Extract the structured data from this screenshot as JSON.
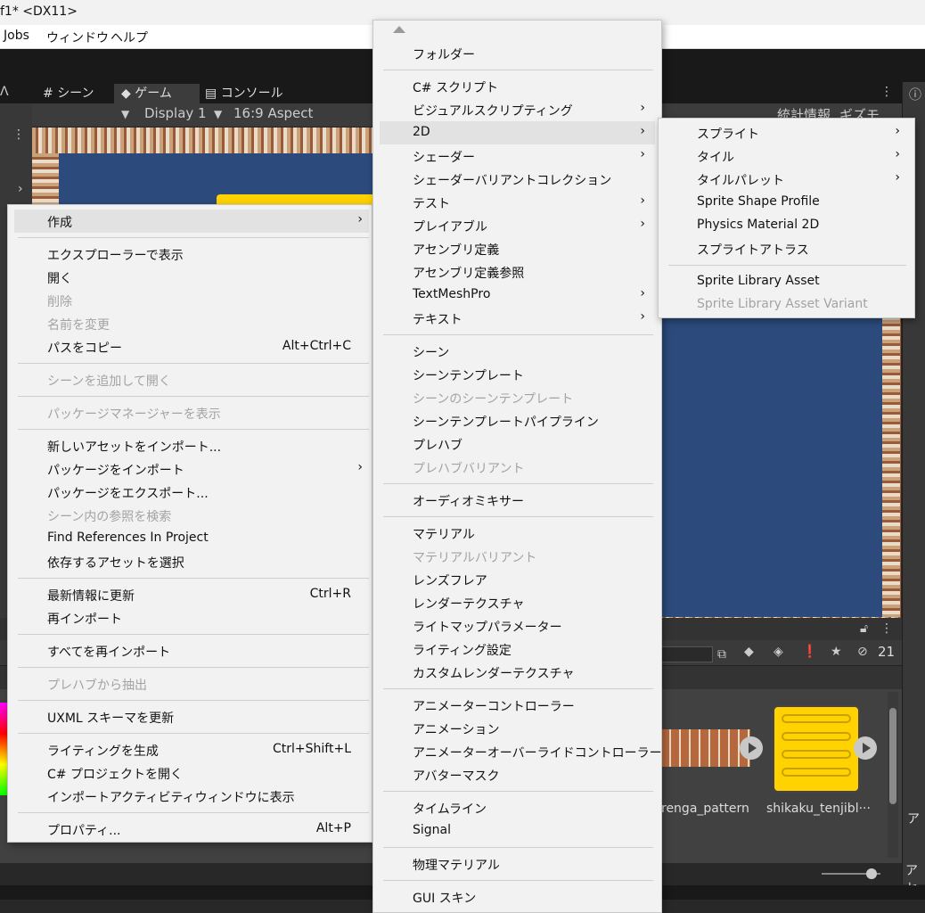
{
  "title": "f1* <DX11>",
  "menubar": [
    "Jobs",
    "ウィンドウ",
    "ヘルプ"
  ],
  "tabs": {
    "scene": "シーン",
    "game": "ゲーム",
    "console": "コンソール"
  },
  "game_toolbar": {
    "display": "Display 1",
    "aspect": "16:9 Aspect",
    "stats": "統計情報",
    "gizmos": "ギズモ"
  },
  "project": {
    "hidden_count": "21",
    "assets": [
      "renga_pattern",
      "shikaku_tenjibl···"
    ]
  },
  "right_panel": {
    "header_a": "ア",
    "footer_a": "アセ"
  },
  "context_menu": [
    {
      "label": "作成",
      "submenu": true,
      "highlighted": true
    },
    {
      "sep": true
    },
    {
      "label": "エクスプローラーで表示"
    },
    {
      "label": "開く"
    },
    {
      "label": "削除",
      "disabled": true
    },
    {
      "label": "名前を変更",
      "disabled": true
    },
    {
      "label": "パスをコピー",
      "shortcut": "Alt+Ctrl+C"
    },
    {
      "sep": true
    },
    {
      "label": "シーンを追加して開く",
      "disabled": true
    },
    {
      "sep": true
    },
    {
      "label": "パッケージマネージャーを表示",
      "disabled": true
    },
    {
      "sep": true
    },
    {
      "label": "新しいアセットをインポート..."
    },
    {
      "label": "パッケージをインポート",
      "submenu": true
    },
    {
      "label": "パッケージをエクスポート..."
    },
    {
      "label": "シーン内の参照を検索",
      "disabled": true
    },
    {
      "label": "Find References In Project"
    },
    {
      "label": "依存するアセットを選択"
    },
    {
      "sep": true
    },
    {
      "label": "最新情報に更新",
      "shortcut": "Ctrl+R"
    },
    {
      "label": "再インポート"
    },
    {
      "sep": true
    },
    {
      "label": "すべてを再インポート"
    },
    {
      "sep": true
    },
    {
      "label": "プレハブから抽出",
      "disabled": true
    },
    {
      "sep": true
    },
    {
      "label": "UXML スキーマを更新"
    },
    {
      "sep": true
    },
    {
      "label": "ライティングを生成",
      "shortcut": "Ctrl+Shift+L"
    },
    {
      "label": "C# プロジェクトを開く"
    },
    {
      "label": "インポートアクティビティウィンドウに表示"
    },
    {
      "sep": true
    },
    {
      "label": "プロパティ...",
      "shortcut": "Alt+P"
    }
  ],
  "create_menu": [
    {
      "label": "フォルダー"
    },
    {
      "sep": true
    },
    {
      "label": "C# スクリプト"
    },
    {
      "label": "ビジュアルスクリプティング",
      "submenu": true
    },
    {
      "label": "2D",
      "submenu": true,
      "highlighted": true
    },
    {
      "label": "シェーダー",
      "submenu": true
    },
    {
      "label": "シェーダーバリアントコレクション"
    },
    {
      "label": "テスト",
      "submenu": true
    },
    {
      "label": "プレイアブル",
      "submenu": true
    },
    {
      "label": "アセンブリ定義"
    },
    {
      "label": "アセンブリ定義参照"
    },
    {
      "label": "TextMeshPro",
      "submenu": true
    },
    {
      "label": "テキスト",
      "submenu": true
    },
    {
      "sep": true
    },
    {
      "label": "シーン"
    },
    {
      "label": "シーンテンプレート"
    },
    {
      "label": "シーンのシーンテンプレート",
      "disabled": true
    },
    {
      "label": "シーンテンプレートパイプライン"
    },
    {
      "label": "プレハブ"
    },
    {
      "label": "プレハブバリアント",
      "disabled": true
    },
    {
      "sep": true
    },
    {
      "label": "オーディオミキサー"
    },
    {
      "sep": true
    },
    {
      "label": "マテリアル"
    },
    {
      "label": "マテリアルバリアント",
      "disabled": true
    },
    {
      "label": "レンズフレア"
    },
    {
      "label": "レンダーテクスチャ"
    },
    {
      "label": "ライトマップパラメーター"
    },
    {
      "label": "ライティング設定"
    },
    {
      "label": "カスタムレンダーテクスチャ"
    },
    {
      "sep": true
    },
    {
      "label": "アニメーターコントローラー"
    },
    {
      "label": "アニメーション"
    },
    {
      "label": "アニメーターオーバーライドコントローラー"
    },
    {
      "label": "アバターマスク"
    },
    {
      "sep": true
    },
    {
      "label": "タイムライン"
    },
    {
      "label": "Signal"
    },
    {
      "sep": true
    },
    {
      "label": "物理マテリアル"
    },
    {
      "sep": true
    },
    {
      "label": "GUI スキン"
    }
  ],
  "submenu_2d": [
    {
      "label": "スプライト",
      "submenu": true
    },
    {
      "label": "タイル",
      "submenu": true
    },
    {
      "label": "タイルパレット",
      "submenu": true
    },
    {
      "label": "Sprite Shape Profile"
    },
    {
      "label": "Physics Material 2D"
    },
    {
      "label": "スプライトアトラス"
    },
    {
      "sep": true
    },
    {
      "label": "Sprite Library Asset"
    },
    {
      "label": "Sprite Library Asset Variant",
      "disabled": true
    }
  ]
}
